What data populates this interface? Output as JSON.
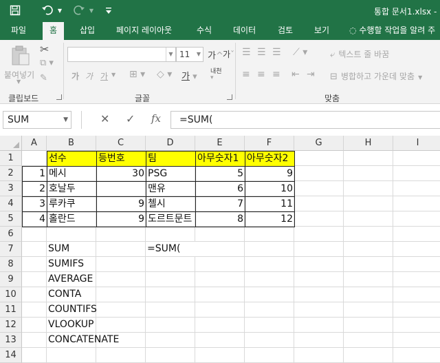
{
  "titlebar": {
    "doc_title": "통합 문서1.xlsx -",
    "qat": {
      "save_icon": "save-icon",
      "undo_icon": "undo-icon",
      "redo_icon": "redo-icon",
      "customize_icon": "customize-qat-icon"
    }
  },
  "tabs": [
    {
      "label": "파일"
    },
    {
      "label": "홈",
      "active": true
    },
    {
      "label": "삽입"
    },
    {
      "label": "페이지 레이아웃"
    },
    {
      "label": "수식"
    },
    {
      "label": "데이터"
    },
    {
      "label": "검토"
    },
    {
      "label": "보기"
    }
  ],
  "tellme": "수행할 작업을 알려 주",
  "ribbon": {
    "paste_label": "붙여넣기",
    "clipboard_label": "클립보드",
    "font_label": "글꼴",
    "align_label": "맞춤",
    "font_name": "",
    "font_size": "11",
    "wrap_text": "텍스트 줄 바꿈",
    "merge_center": "병합하고 가운데 맞춤",
    "bold": "가",
    "italic": "가",
    "underline": "가",
    "grow": "가",
    "shrink": "가",
    "font_color": "가",
    "phonetic": "내천"
  },
  "formula_bar": {
    "name_box": "SUM",
    "formula": "=SUM(",
    "cancel": "✕",
    "enter": "✓",
    "fx": "fx"
  },
  "sheet": {
    "columns": [
      "A",
      "B",
      "C",
      "D",
      "E",
      "F",
      "G",
      "H",
      "I"
    ],
    "rows": [
      "1",
      "2",
      "3",
      "4",
      "5",
      "6",
      "7",
      "8",
      "9",
      "10",
      "11",
      "12",
      "13",
      "14"
    ],
    "header": [
      "선수",
      "등번호",
      "팀",
      "아무숫자1",
      "아무숫자2"
    ],
    "data": [
      {
        "a": "1",
        "b": "메시",
        "c": "30",
        "d": "PSG",
        "e": "5",
        "f": "9"
      },
      {
        "a": "2",
        "b": "호날두",
        "c": "",
        "d": "맨유",
        "e": "6",
        "f": "10"
      },
      {
        "a": "3",
        "b": "루카쿠",
        "c": "9",
        "d": "첼시",
        "e": "7",
        "f": "11"
      },
      {
        "a": "4",
        "b": "홀란드",
        "c": "9",
        "d": "도르트문트",
        "e": "8",
        "f": "12"
      }
    ],
    "functions": [
      "SUM",
      "SUMIFS",
      "AVERAGE",
      "CONTA",
      "COUNTIFS",
      "VLOOKUP",
      "CONCATENATE"
    ],
    "d7": "=SUM("
  },
  "colors": {
    "accent": "#217346",
    "highlight": "#ffff00"
  }
}
